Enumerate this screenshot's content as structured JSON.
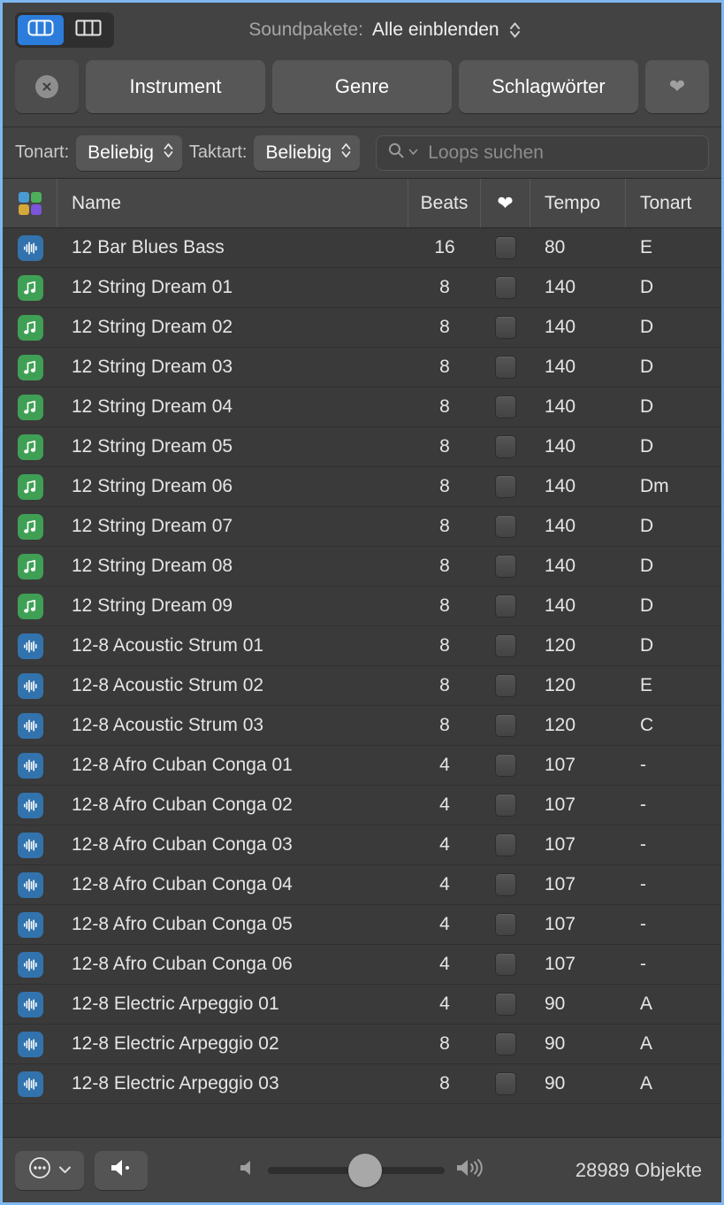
{
  "toolbar": {
    "view_grid_label": "grid-view",
    "view_column_label": "column-view",
    "soundpacks_label": "Soundpakete:",
    "soundpacks_value": "Alle einblenden"
  },
  "filters": {
    "reset_label": "",
    "instrument": "Instrument",
    "genre": "Genre",
    "keywords": "Schlagwörter",
    "favorites": ""
  },
  "filterbar": {
    "key_label": "Tonart:",
    "key_value": "Beliebig",
    "time_label": "Taktart:",
    "time_value": "Beliebig",
    "search_placeholder": "Loops suchen"
  },
  "table": {
    "columns": {
      "icon": "",
      "name": "Name",
      "beats": "Beats",
      "fav": "",
      "tempo": "Tempo",
      "key": "Tonart"
    },
    "rows": [
      {
        "type": "audio",
        "name": "12 Bar Blues Bass",
        "beats": "16",
        "tempo": "80",
        "key": "E"
      },
      {
        "type": "midi",
        "name": "12 String Dream 01",
        "beats": "8",
        "tempo": "140",
        "key": "D"
      },
      {
        "type": "midi",
        "name": "12 String Dream 02",
        "beats": "8",
        "tempo": "140",
        "key": "D"
      },
      {
        "type": "midi",
        "name": "12 String Dream 03",
        "beats": "8",
        "tempo": "140",
        "key": "D"
      },
      {
        "type": "midi",
        "name": "12 String Dream 04",
        "beats": "8",
        "tempo": "140",
        "key": "D"
      },
      {
        "type": "midi",
        "name": "12 String Dream 05",
        "beats": "8",
        "tempo": "140",
        "key": "D"
      },
      {
        "type": "midi",
        "name": "12 String Dream 06",
        "beats": "8",
        "tempo": "140",
        "key": "Dm"
      },
      {
        "type": "midi",
        "name": "12 String Dream 07",
        "beats": "8",
        "tempo": "140",
        "key": "D"
      },
      {
        "type": "midi",
        "name": "12 String Dream 08",
        "beats": "8",
        "tempo": "140",
        "key": "D"
      },
      {
        "type": "midi",
        "name": "12 String Dream 09",
        "beats": "8",
        "tempo": "140",
        "key": "D"
      },
      {
        "type": "audio",
        "name": "12-8 Acoustic Strum 01",
        "beats": "8",
        "tempo": "120",
        "key": "D"
      },
      {
        "type": "audio",
        "name": "12-8 Acoustic Strum 02",
        "beats": "8",
        "tempo": "120",
        "key": "E"
      },
      {
        "type": "audio",
        "name": "12-8 Acoustic Strum 03",
        "beats": "8",
        "tempo": "120",
        "key": "C"
      },
      {
        "type": "audio",
        "name": "12-8 Afro Cuban Conga 01",
        "beats": "4",
        "tempo": "107",
        "key": "-"
      },
      {
        "type": "audio",
        "name": "12-8 Afro Cuban Conga 02",
        "beats": "4",
        "tempo": "107",
        "key": "-"
      },
      {
        "type": "audio",
        "name": "12-8 Afro Cuban Conga 03",
        "beats": "4",
        "tempo": "107",
        "key": "-"
      },
      {
        "type": "audio",
        "name": "12-8 Afro Cuban Conga 04",
        "beats": "4",
        "tempo": "107",
        "key": "-"
      },
      {
        "type": "audio",
        "name": "12-8 Afro Cuban Conga 05",
        "beats": "4",
        "tempo": "107",
        "key": "-"
      },
      {
        "type": "audio",
        "name": "12-8 Afro Cuban Conga 06",
        "beats": "4",
        "tempo": "107",
        "key": "-"
      },
      {
        "type": "audio",
        "name": "12-8 Electric Arpeggio 01",
        "beats": "4",
        "tempo": "90",
        "key": "A"
      },
      {
        "type": "audio",
        "name": "12-8 Electric Arpeggio 02",
        "beats": "8",
        "tempo": "90",
        "key": "A"
      },
      {
        "type": "audio",
        "name": "12-8 Electric Arpeggio 03",
        "beats": "8",
        "tempo": "90",
        "key": "A"
      }
    ]
  },
  "bottom": {
    "object_count": "28989 Objekte",
    "volume_percent": 55
  },
  "colors": {
    "accent": "#2c7ddb",
    "window_border": "#7fb8f0",
    "audio_icon": "#3273ad",
    "midi_icon": "#3fa055",
    "toolbar_bg": "#434343",
    "list_bg": "#3a3a3a"
  }
}
